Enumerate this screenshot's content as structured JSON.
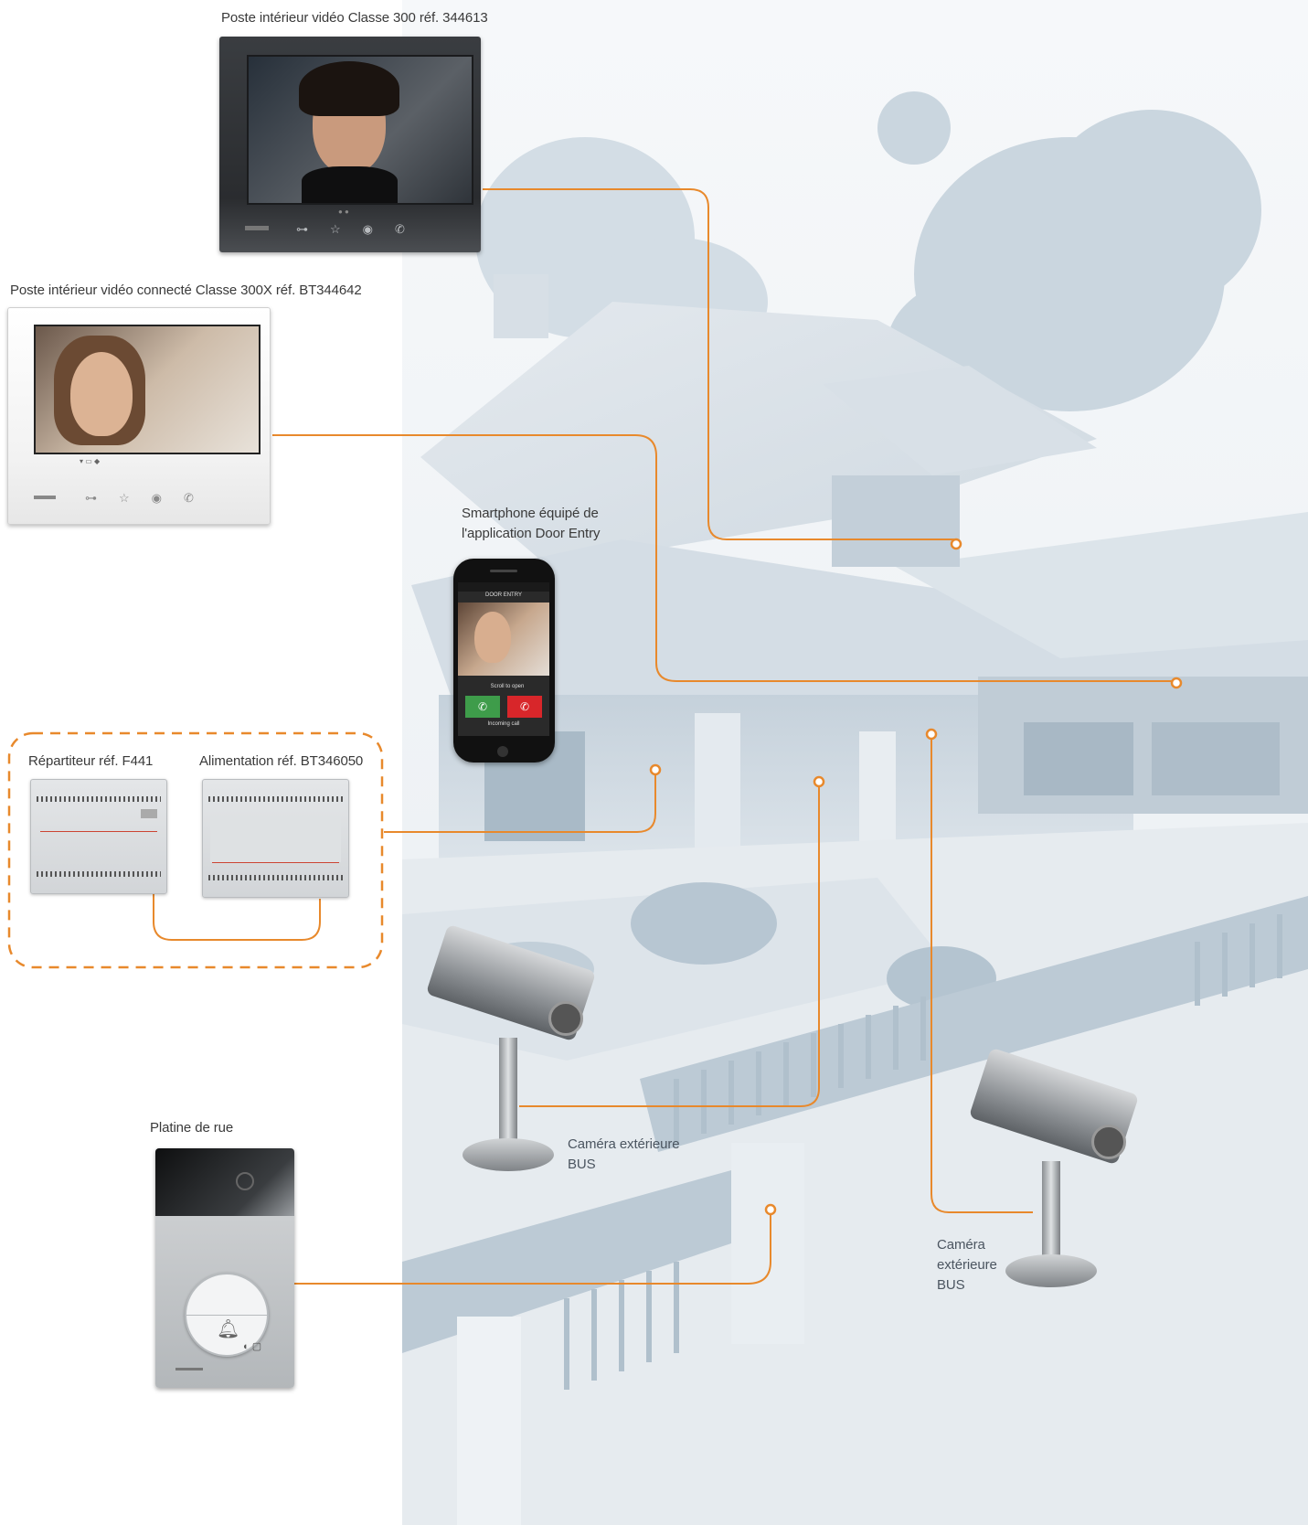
{
  "labels": {
    "monitor_dark": "Poste intérieur vidéo Classe 300 réf. 344613",
    "monitor_light": "Poste intérieur vidéo connecté Classe 300X réf. BT344642",
    "smartphone_line1": "Smartphone équipé de",
    "smartphone_line2": "l'application Door Entry",
    "distributor": "Répartiteur réf. F441",
    "power_supply": "Alimentation réf. BT346050",
    "door_panel": "Platine de rue",
    "camera1_line1": "Caméra extérieure",
    "camera1_line2": "BUS",
    "camera2_line1": "Caméra",
    "camera2_line2": "extérieure",
    "camera2_line3": "BUS"
  },
  "phone_screen": {
    "app_title": "DOOR ENTRY",
    "scroll_text": "Scroll to open",
    "status_text": "Incoming call"
  },
  "colors": {
    "connection_line": "#e8892c",
    "group_border": "#e8892c",
    "house_tint": "#c9d6e0"
  },
  "icons": {
    "monitor_buttons": [
      "key-icon",
      "star-icon",
      "eye-icon",
      "phone-icon"
    ],
    "doorplate_button": "bell-icon",
    "phone_answer": "phone-answer-icon",
    "phone_hangup": "phone-hangup-icon"
  }
}
